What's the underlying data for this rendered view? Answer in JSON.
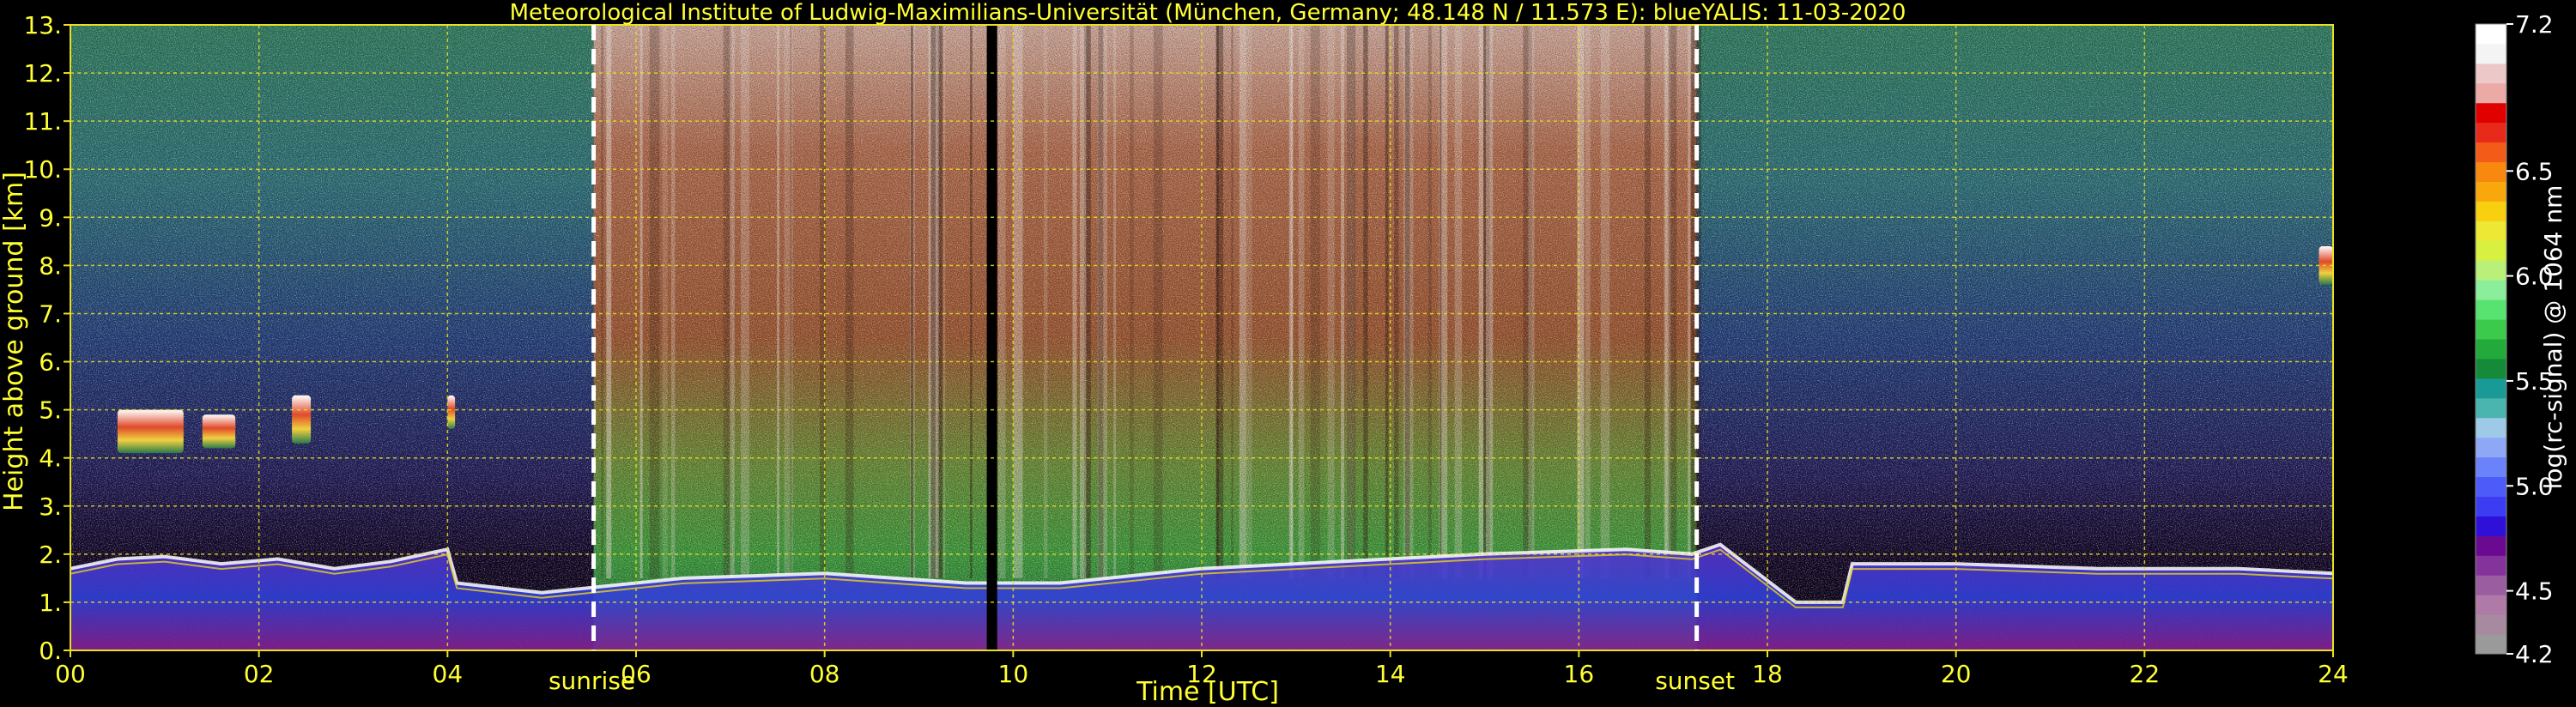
{
  "chart_data": {
    "type": "heatmap",
    "title": "Meteorological Institute of Ludwig-Maximilians-Universität (München, Germany; 48.148 N / 11.573 E):     blueYALIS: 11-03-2020",
    "xlabel": "Time [UTC]",
    "ylabel": "Height above ground [km]",
    "xlim": [
      0,
      24
    ],
    "ylim": [
      0,
      13
    ],
    "x_ticks": [
      "00",
      "02",
      "04",
      "06",
      "08",
      "10",
      "12",
      "14",
      "16",
      "18",
      "20",
      "22",
      "24"
    ],
    "x_tick_values": [
      0,
      2,
      4,
      6,
      8,
      10,
      12,
      14,
      16,
      18,
      20,
      22,
      24
    ],
    "y_ticks": [
      "0.",
      "1.",
      "2.",
      "3.",
      "4.",
      "5.",
      "6.",
      "7.",
      "8.",
      "9.",
      "10.",
      "11.",
      "12.",
      "13."
    ],
    "y_tick_values": [
      0,
      1,
      2,
      3,
      4,
      5,
      6,
      7,
      8,
      9,
      10,
      11,
      12,
      13
    ],
    "grid": true,
    "annotations": [
      {
        "text": "sunrise",
        "x": 5.55
      },
      {
        "text": "sunset",
        "x": 17.25
      }
    ],
    "data_gap": {
      "x_start": 9.72,
      "x_end": 9.83
    },
    "boundary_layer_top_km": [
      [
        0.0,
        1.7
      ],
      [
        0.5,
        1.9
      ],
      [
        1.0,
        1.95
      ],
      [
        1.6,
        1.8
      ],
      [
        2.2,
        1.9
      ],
      [
        2.8,
        1.7
      ],
      [
        3.4,
        1.85
      ],
      [
        4.0,
        2.1
      ],
      [
        4.1,
        1.4
      ],
      [
        5.0,
        1.2
      ],
      [
        5.5,
        1.3
      ],
      [
        6.5,
        1.5
      ],
      [
        8.0,
        1.6
      ],
      [
        9.5,
        1.4
      ],
      [
        10.5,
        1.4
      ],
      [
        12.0,
        1.7
      ],
      [
        13.5,
        1.85
      ],
      [
        15.0,
        2.0
      ],
      [
        16.5,
        2.1
      ],
      [
        17.2,
        2.0
      ],
      [
        17.5,
        2.2
      ],
      [
        18.3,
        1.0
      ],
      [
        18.8,
        1.0
      ],
      [
        18.9,
        1.8
      ],
      [
        20.0,
        1.8
      ],
      [
        21.5,
        1.7
      ],
      [
        23.0,
        1.7
      ],
      [
        24.0,
        1.6
      ]
    ],
    "clouds": [
      {
        "x0": 0.5,
        "x1": 1.2,
        "y0": 4.1,
        "y1": 5.0
      },
      {
        "x0": 1.4,
        "x1": 1.75,
        "y0": 4.2,
        "y1": 4.9
      },
      {
        "x0": 2.35,
        "x1": 2.55,
        "y0": 4.3,
        "y1": 5.3
      },
      {
        "x0": 4.0,
        "x1": 4.08,
        "y0": 4.6,
        "y1": 5.3
      },
      {
        "x0": 23.85,
        "x1": 24.0,
        "y0": 7.6,
        "y1": 8.4
      }
    ],
    "colorbar": {
      "label": "log(rc-signal) @ 1064 nm",
      "range": [
        4.2,
        7.2
      ],
      "tick_values": [
        4.2,
        4.5,
        5.0,
        5.5,
        6.0,
        6.5,
        7.2
      ],
      "tick_labels": [
        "4.2",
        "4.5",
        "5.0",
        "5.5",
        "6.0",
        "6.5",
        "7.2"
      ],
      "colors": [
        "#9a9a9a",
        "#a88aa0",
        "#b07aa8",
        "#9a5ea0",
        "#84339a",
        "#6a0a90",
        "#2e10d8",
        "#3c3cf2",
        "#4d5cf8",
        "#6a82fa",
        "#8ea8f6",
        "#9ecae8",
        "#4ab4ae",
        "#1a9a96",
        "#158a38",
        "#22aa3a",
        "#3cca4c",
        "#58e270",
        "#8aee9a",
        "#b8f07a",
        "#d8f040",
        "#ece834",
        "#f8d010",
        "#f8a80c",
        "#f8880e",
        "#f25c18",
        "#e82a1a",
        "#e00000",
        "#ecaaa6",
        "#ecc8c8",
        "#f4f4f4",
        "#ffffff"
      ]
    }
  }
}
